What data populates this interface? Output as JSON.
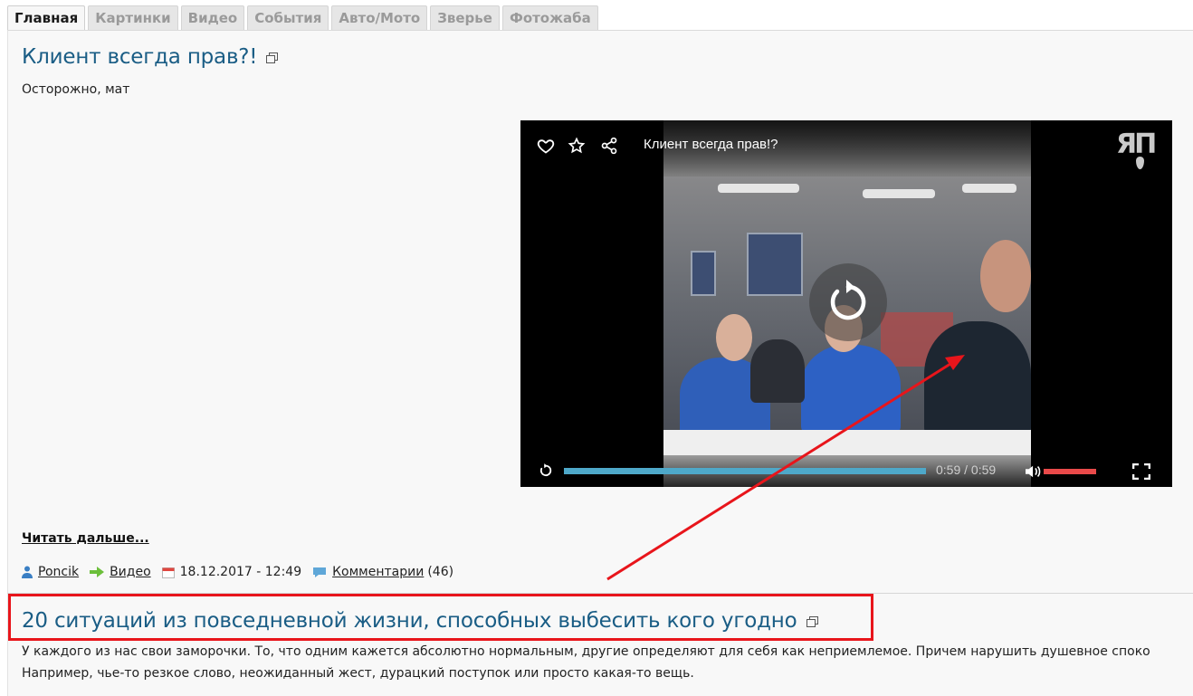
{
  "tabs": [
    {
      "label": "Главная",
      "active": true
    },
    {
      "label": "Картинки"
    },
    {
      "label": "Видео"
    },
    {
      "label": "События"
    },
    {
      "label": "Авто/Мото"
    },
    {
      "label": "Зверье"
    },
    {
      "label": "Фотожаба"
    }
  ],
  "post1": {
    "title": "Клиент всегда прав?!",
    "subtitle": "Осторожно, мат",
    "video": {
      "title": "Клиент всегда прав!?",
      "logo": "ЯП",
      "time_current": "0:59",
      "time_separator": "/",
      "time_total": "0:59",
      "progress": 1.0,
      "volume": 1.0,
      "icons": [
        "heart-icon",
        "star-icon",
        "share-icon",
        "replay-icon",
        "volume-icon",
        "fullscreen-icon"
      ]
    },
    "read_more": "Читать дальше...",
    "meta": {
      "author": "Poncik",
      "category": "Видео",
      "datetime": "18.12.2017 - 12:49",
      "comments_label": "Комментарии",
      "comments_count": "(46)"
    }
  },
  "post2": {
    "title": "20 ситуаций из повседневной жизни, способных выбесить кого угодно",
    "line1": "У каждого из нас свои заморочки. То, что одним кажется абсолютно нормальным, другие определяют для себя как неприемлемое. Причем нарушить душевное споко",
    "line2": "Например, чье-то резкое слово, неожиданный жест, дурацкий поступок или просто какая-то вещь."
  },
  "colors": {
    "title": "#1a5d85",
    "annotation": "#e8151b",
    "progress": "#4ea8c9",
    "volume": "#e94a4a"
  }
}
